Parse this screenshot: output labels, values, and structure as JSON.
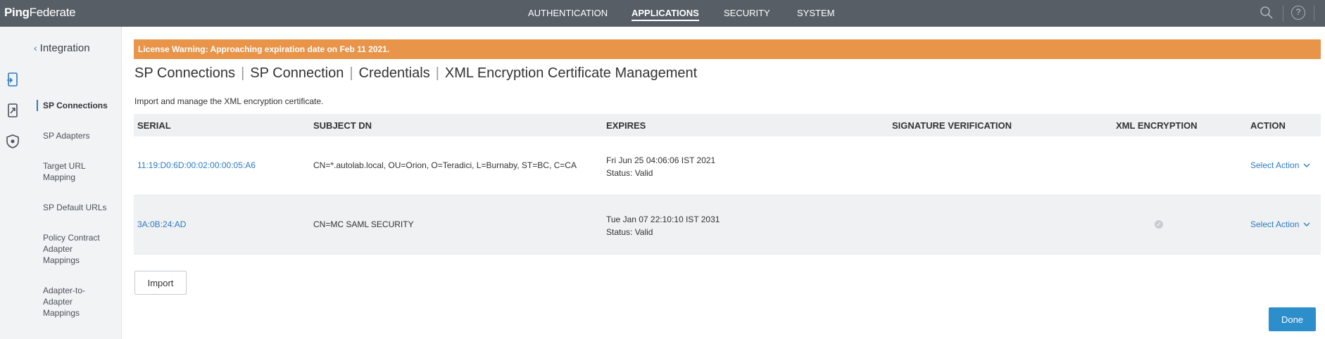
{
  "app": {
    "logo_part1": "Ping",
    "logo_part2": "Federate"
  },
  "topnav": {
    "items": [
      {
        "label": "AUTHENTICATION"
      },
      {
        "label": "APPLICATIONS",
        "active": true
      },
      {
        "label": "SECURITY"
      },
      {
        "label": "SYSTEM"
      }
    ],
    "help_glyph": "?"
  },
  "sidebar": {
    "back_label": "Integration",
    "items": [
      {
        "label": "SP Connections",
        "active": true
      },
      {
        "label": "SP Adapters"
      },
      {
        "label": "Target URL Mapping"
      },
      {
        "label": "SP Default URLs"
      },
      {
        "label": "Policy Contract Adapter Mappings"
      },
      {
        "label": "Adapter-to-Adapter Mappings"
      }
    ]
  },
  "banner": {
    "text": "License Warning: Approaching expiration date on Feb 11 2021."
  },
  "breadcrumb": [
    "SP Connections",
    "SP Connection",
    "Credentials",
    "XML Encryption Certificate Management"
  ],
  "description": "Import and manage the XML encryption certificate.",
  "table": {
    "headers": {
      "serial": "SERIAL",
      "subject": "SUBJECT DN",
      "expires": "EXPIRES",
      "sigver": "SIGNATURE VERIFICATION",
      "xmlenc": "XML ENCRYPTION",
      "action": "ACTION"
    },
    "rows": [
      {
        "serial": "11:19:D0:6D:00:02:00:00:05:A6",
        "subject": "CN=*.autolab.local, OU=Orion, O=Teradici, L=Burnaby, ST=BC, C=CA",
        "expires": "Fri Jun 25 04:06:06 IST 2021",
        "status": "Status:  Valid",
        "xml_encryption": false,
        "action": "Select Action"
      },
      {
        "serial": "3A:0B:24:AD",
        "subject": "CN=MC SAML SECURITY",
        "expires": "Tue Jan 07 22:10:10 IST 2031",
        "status": "Status:  Valid",
        "xml_encryption": true,
        "action": "Select Action"
      }
    ]
  },
  "buttons": {
    "import": "Import",
    "done": "Done"
  },
  "colors": {
    "topbar": "#575e66",
    "banner": "#e8954a",
    "link": "#2c7cc1",
    "primary_button": "#2c8ecb"
  }
}
